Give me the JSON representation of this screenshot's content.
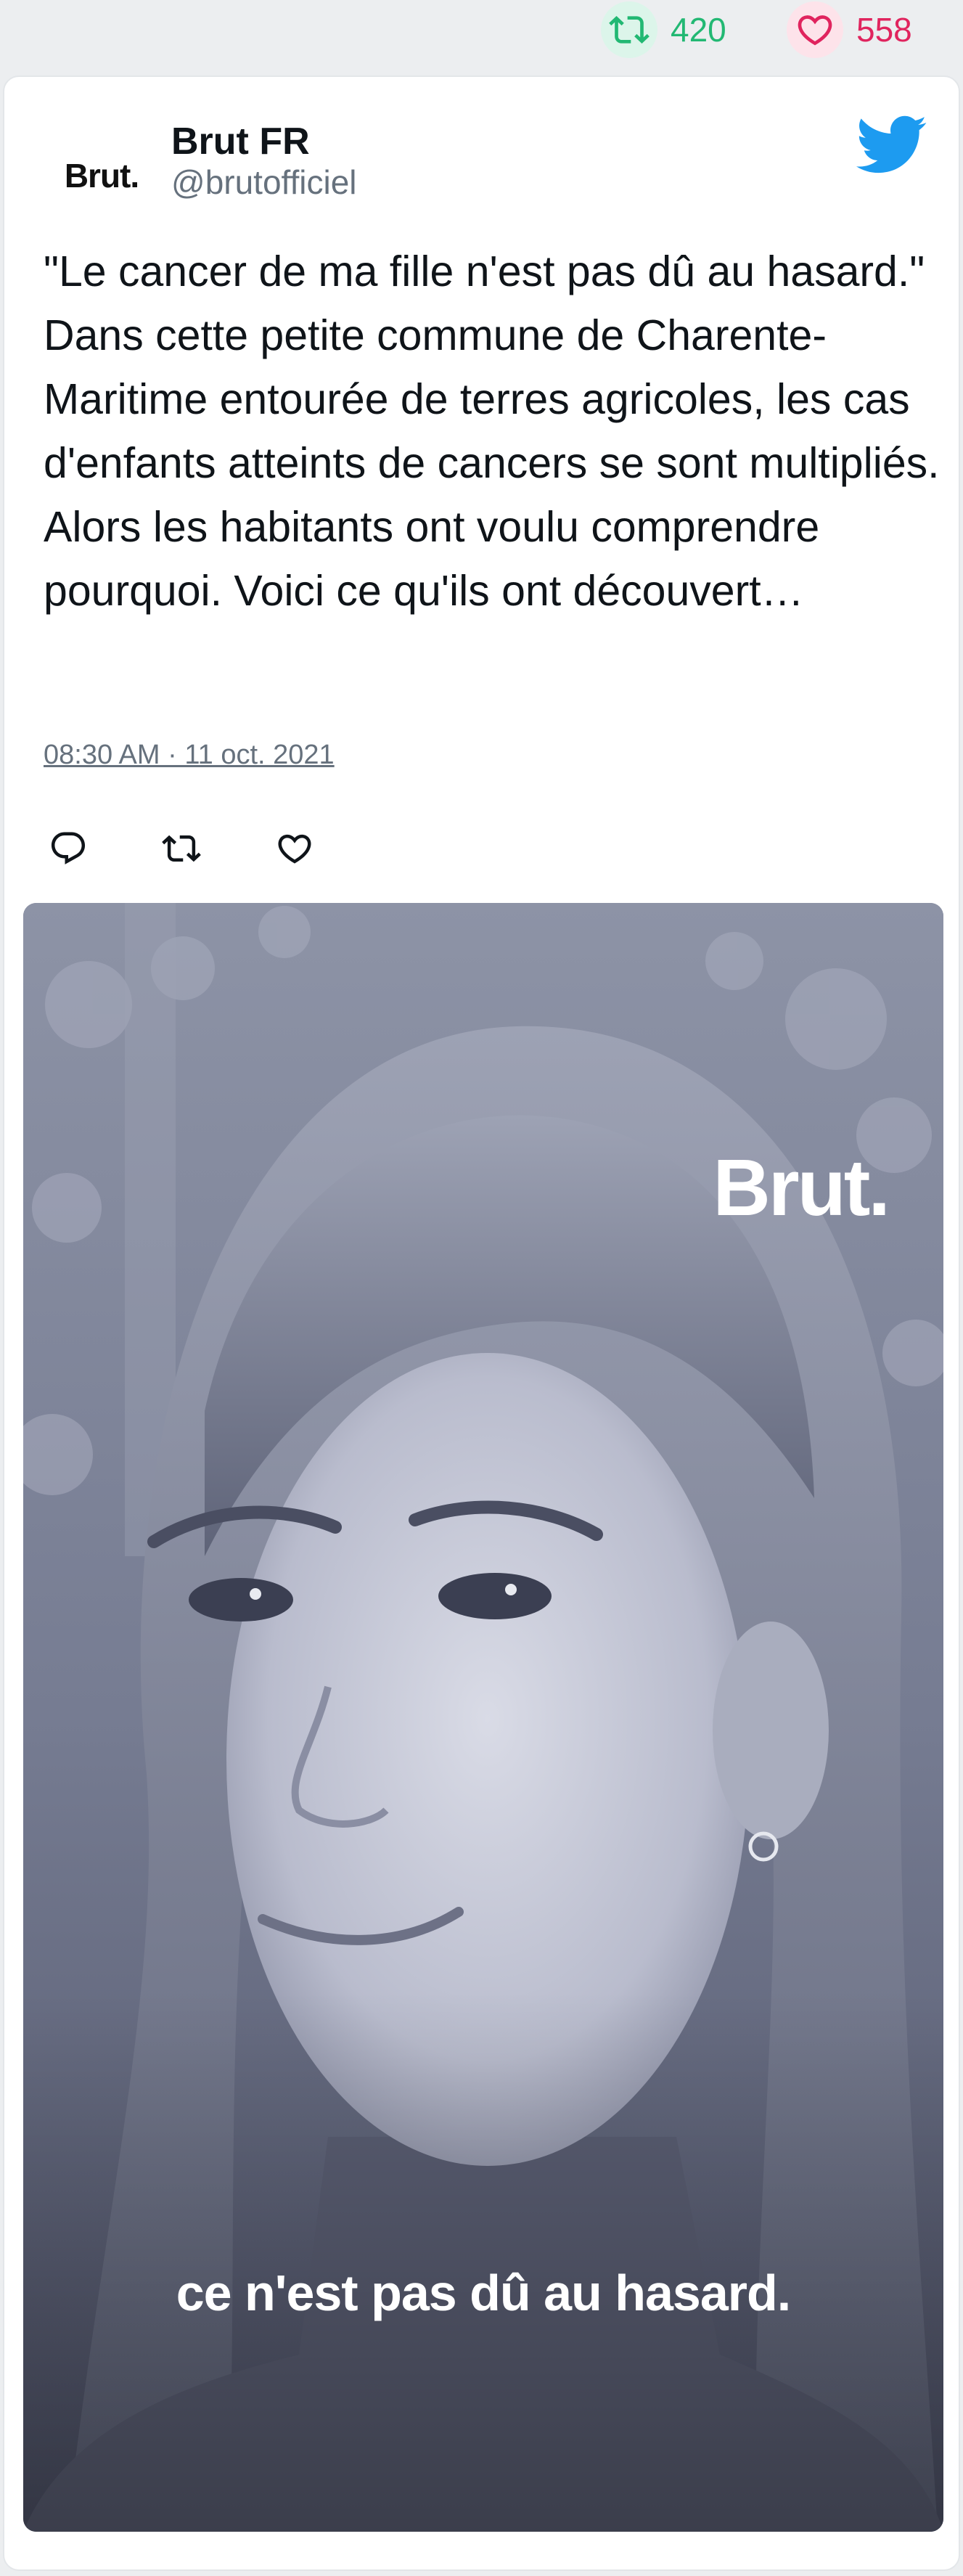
{
  "stats": {
    "retweet_count": "420",
    "like_count": "558",
    "retweet_icon": "retweet-icon",
    "like_icon": "heart-icon"
  },
  "tweet": {
    "avatar_text": "Brut.",
    "author_name": "Brut FR",
    "author_handle": "@brutofficiel",
    "text": "\"Le cancer de ma fille n'est pas dû au hasard.\" Dans cette petite commune de Charente-Maritime entourée de terres agricoles, les cas d'enfants atteints de cancers se sont multipliés. Alors les habitants ont voulu comprendre pourquoi. Voici ce qu'ils ont découvert…",
    "timestamp": "08:30 AM · 11 oct. 2021",
    "actions": [
      "reply-icon",
      "retweet-icon",
      "heart-icon"
    ]
  },
  "media": {
    "brand_overlay": "Brut.",
    "caption": "ce n'est pas dû au hasard."
  },
  "colors": {
    "retweet": "#22b873",
    "like": "#e0245e",
    "twitter_blue": "#1d9bf0",
    "muted": "#66717d"
  }
}
